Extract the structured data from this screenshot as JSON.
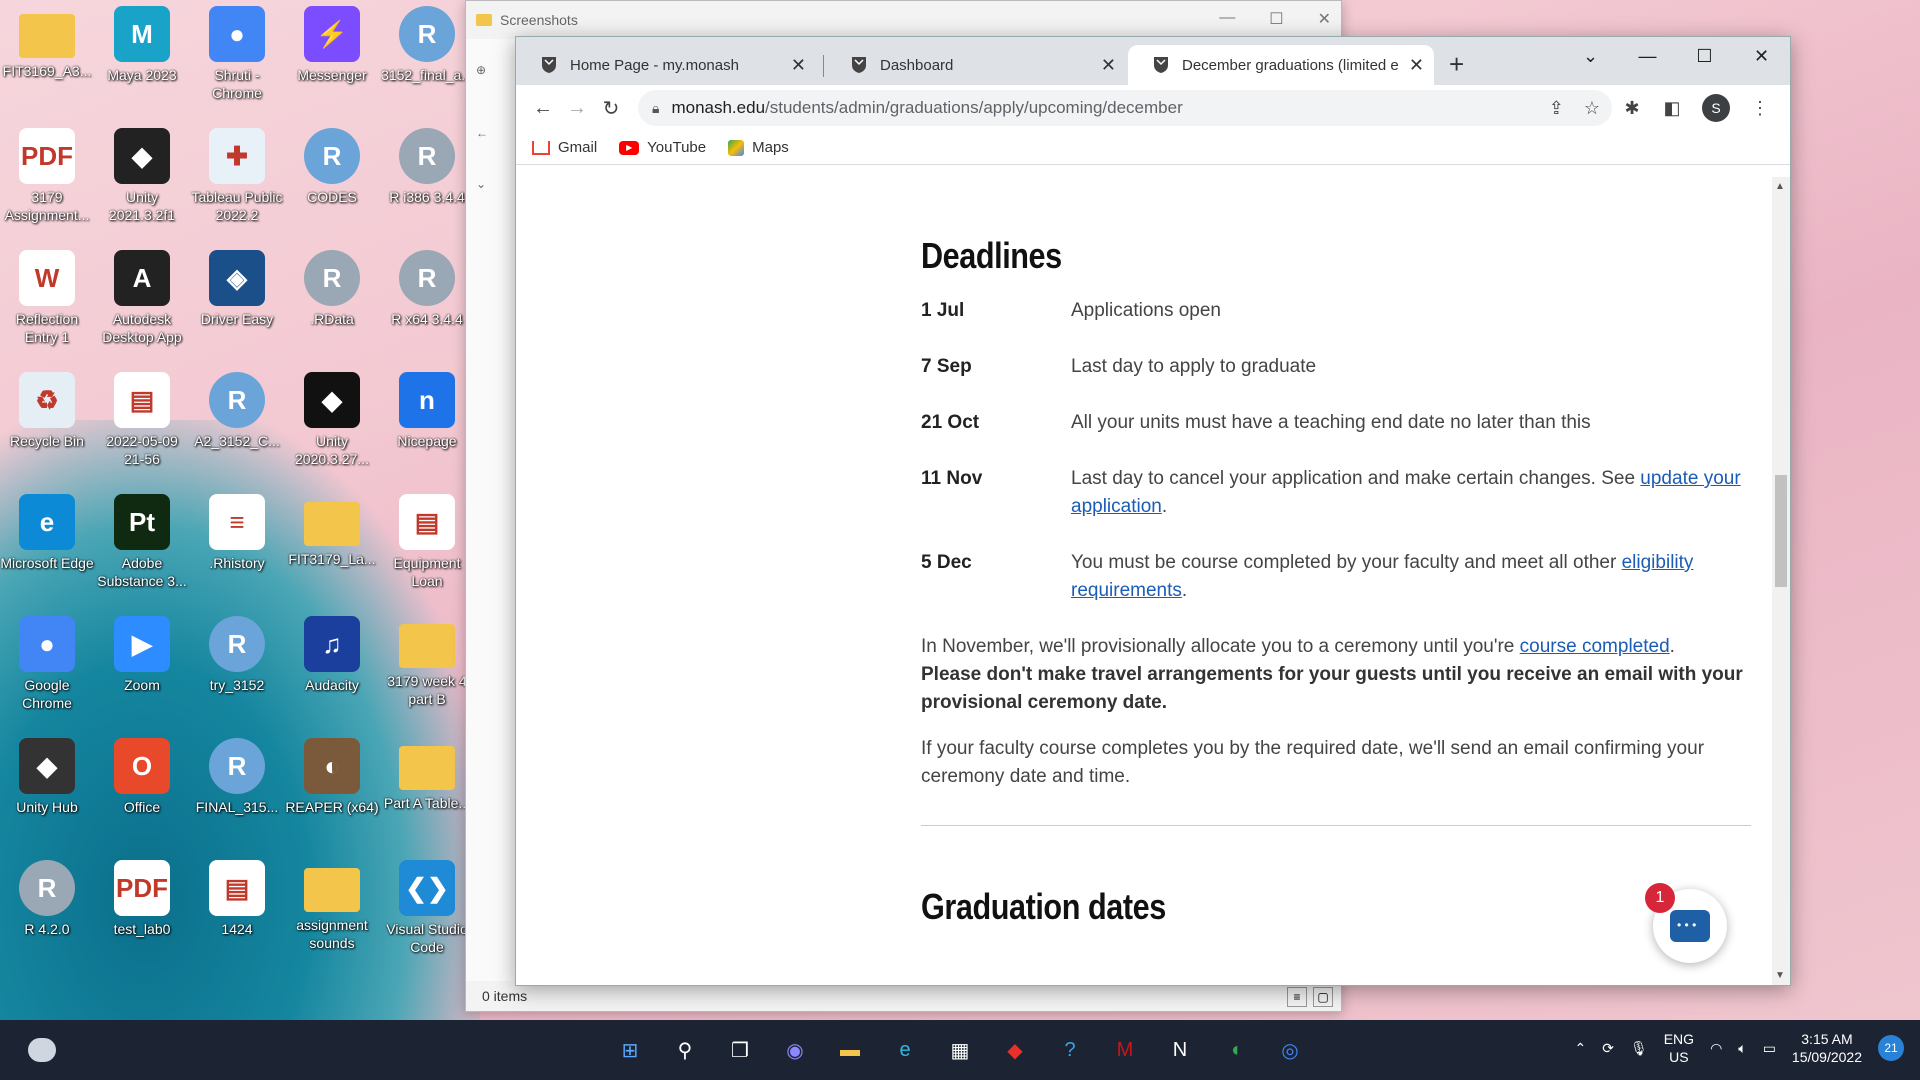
{
  "desktop": {
    "icons": [
      {
        "label": "FIT3169_A3...",
        "color": "#f3c54a",
        "glyph": ""
      },
      {
        "label": "Maya 2023",
        "color": "#1aa3c8",
        "glyph": "M"
      },
      {
        "label": "Shruti - Chrome",
        "color": "#4285f4",
        "glyph": "●"
      },
      {
        "label": "Messenger",
        "color": "#7b4dff",
        "glyph": "⚡"
      },
      {
        "label": "3152_final_a...",
        "color": "#6aa4d8",
        "glyph": "R"
      },
      {
        "label": "3179 Assignment...",
        "color": "#ffffff",
        "glyph": "PDF"
      },
      {
        "label": "Unity 2021.3.2f1",
        "color": "#222222",
        "glyph": "◆"
      },
      {
        "label": "Tableau Public 2022.2",
        "color": "#e8f0f8",
        "glyph": "✚"
      },
      {
        "label": "CODES",
        "color": "#6aa4d8",
        "glyph": "R"
      },
      {
        "label": "R i386 3.4.4",
        "color": "#9aa7b5",
        "glyph": "R"
      },
      {
        "label": "Reflection Entry 1",
        "color": "#ffffff",
        "glyph": "W"
      },
      {
        "label": "Autodesk Desktop App",
        "color": "#222222",
        "glyph": "A"
      },
      {
        "label": "Driver Easy",
        "color": "#1a4f8a",
        "glyph": "◈"
      },
      {
        "label": ".RData",
        "color": "#9aa7b5",
        "glyph": "R"
      },
      {
        "label": "R x64 3.4.4",
        "color": "#9aa7b5",
        "glyph": "R"
      },
      {
        "label": "Recycle Bin",
        "color": "#e6eef5",
        "glyph": "♻"
      },
      {
        "label": "2022-05-09 21-56",
        "color": "#ffffff",
        "glyph": "▤"
      },
      {
        "label": "A2_3152_C...",
        "color": "#6aa4d8",
        "glyph": "R"
      },
      {
        "label": "Unity 2020.3.27...",
        "color": "#111111",
        "glyph": "◆"
      },
      {
        "label": "Nicepage",
        "color": "#1e73e8",
        "glyph": "n"
      },
      {
        "label": "Microsoft Edge",
        "color": "#0c8ad6",
        "glyph": "e"
      },
      {
        "label": "Adobe Substance 3...",
        "color": "#0f2a10",
        "glyph": "Pt"
      },
      {
        "label": ".Rhistory",
        "color": "#ffffff",
        "glyph": "≡"
      },
      {
        "label": "FIT3179_La...",
        "color": "#f3c54a",
        "glyph": ""
      },
      {
        "label": "Equipment Loan",
        "color": "#ffffff",
        "glyph": "▤"
      },
      {
        "label": "Google Chrome",
        "color": "#4285f4",
        "glyph": "●"
      },
      {
        "label": "Zoom",
        "color": "#2d8cff",
        "glyph": "▶"
      },
      {
        "label": "try_3152",
        "color": "#6aa4d8",
        "glyph": "R"
      },
      {
        "label": "Audacity",
        "color": "#1a3f9c",
        "glyph": "♫"
      },
      {
        "label": "3179 week 4 part B",
        "color": "#f3c54a",
        "glyph": ""
      },
      {
        "label": "Unity Hub",
        "color": "#333333",
        "glyph": "◆"
      },
      {
        "label": "Office",
        "color": "#e8492a",
        "glyph": "O"
      },
      {
        "label": "FINAL_315...",
        "color": "#6aa4d8",
        "glyph": "R"
      },
      {
        "label": "REAPER (x64)",
        "color": "#7a5a3a",
        "glyph": "◐"
      },
      {
        "label": "Part A Table...",
        "color": "#f3c54a",
        "glyph": ""
      },
      {
        "label": "R 4.2.0",
        "color": "#9aa7b5",
        "glyph": "R"
      },
      {
        "label": "test_lab0",
        "color": "#ffffff",
        "glyph": "PDF"
      },
      {
        "label": "1424",
        "color": "#ffffff",
        "glyph": "▤"
      },
      {
        "label": "assignment sounds",
        "color": "#f3c54a",
        "glyph": ""
      },
      {
        "label": "Visual Studio Code",
        "color": "#1f8ad6",
        "glyph": "❮❯"
      }
    ]
  },
  "explorer": {
    "title": "Screenshots",
    "status": "0 items"
  },
  "browser": {
    "tabs": [
      {
        "title": "Home Page - my.monash"
      },
      {
        "title": "Dashboard"
      },
      {
        "title": "December graduations (limited e"
      }
    ],
    "url_host": "monash.edu",
    "url_path": "/students/admin/graduations/apply/upcoming/december",
    "bookmarks": [
      "Gmail",
      "YouTube",
      "Maps"
    ],
    "profile_initial": "S"
  },
  "page": {
    "deadlines_heading": "Deadlines",
    "deadlines": [
      {
        "date": "1 Jul",
        "text": "Applications open"
      },
      {
        "date": "7 Sep",
        "text": "Last day to apply to graduate"
      },
      {
        "date": "21 Oct",
        "text": "All your units must have a teaching end date no later than this"
      },
      {
        "date": "11 Nov",
        "text": "Last day to cancel your application and make certain changes. See ",
        "link": "update your application",
        "after": "."
      },
      {
        "date": "5 Dec",
        "text": "You must be course completed by your faculty and meet all other ",
        "link": "eligibility requirements",
        "after": "."
      }
    ],
    "para1_text": "In November, we'll provisionally allocate you to a ceremony until you're ",
    "para1_link": "course completed",
    "para1_after": ".",
    "para1_bold": "Please don't make travel arrangements for your guests until you receive an email with your provisional ceremony date.",
    "para2": "If your faculty course completes you by the required date, we'll send an email confirming your ceremony date and time.",
    "graduation_heading": "Graduation dates",
    "chat_badge": "1"
  },
  "taskbar": {
    "lang_line1": "ENG",
    "lang_line2": "US",
    "time": "3:15 AM",
    "date": "15/09/2022",
    "notifications": "21"
  }
}
